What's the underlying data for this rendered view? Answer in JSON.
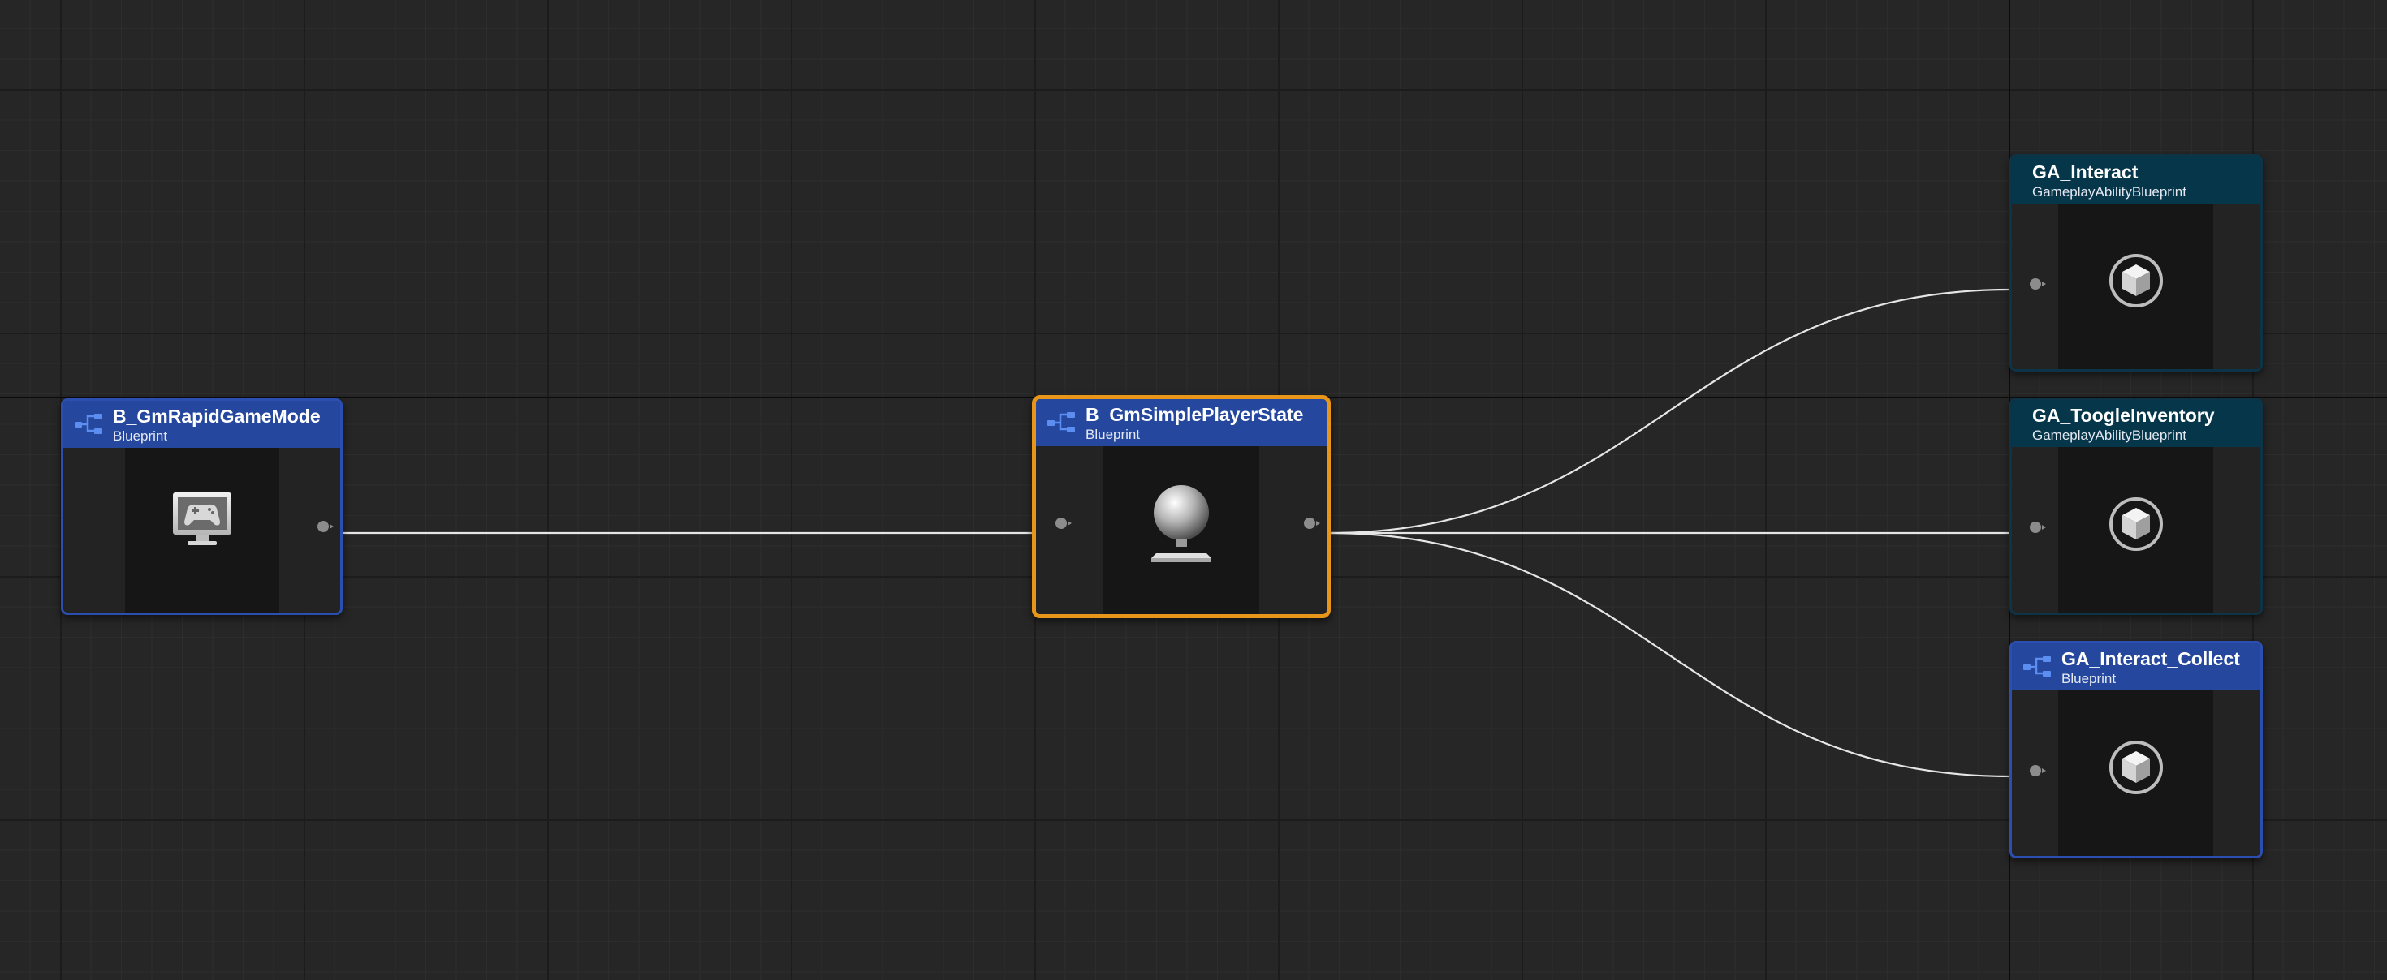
{
  "graph": {
    "nodes": [
      {
        "id": "game-mode",
        "title": "B_GmRapidGameMode",
        "subtitle": "Blueprint",
        "icon": "gamepad-monitor-icon",
        "header_icon": "blueprint-hierarchy-icon",
        "selected": false
      },
      {
        "id": "player-state",
        "title": "B_GmSimplePlayerState",
        "subtitle": "Blueprint",
        "icon": "sphere-pedestal-icon",
        "header_icon": "blueprint-hierarchy-icon",
        "selected": true
      },
      {
        "id": "ga-interact",
        "title": "GA_Interact",
        "subtitle": "GameplayAbilityBlueprint",
        "icon": "cube-circle-icon",
        "selected": false
      },
      {
        "id": "ga-toogle-inventory",
        "title": "GA_ToogleInventory",
        "subtitle": "GameplayAbilityBlueprint",
        "icon": "cube-circle-icon",
        "selected": false
      },
      {
        "id": "ga-interact-collect",
        "title": "GA_Interact_Collect",
        "subtitle": "Blueprint",
        "icon": "cube-circle-icon",
        "header_icon": "blueprint-hierarchy-icon",
        "selected": false
      }
    ],
    "connections": [
      {
        "from": "game-mode",
        "to": "player-state"
      },
      {
        "from": "player-state",
        "to": "ga-interact"
      },
      {
        "from": "player-state",
        "to": "ga-toogle-inventory"
      },
      {
        "from": "player-state",
        "to": "ga-interact-collect"
      }
    ]
  },
  "colors": {
    "blueprint_header": "#25489e",
    "blueprint_border": "#2a4fb0",
    "gameplay_ability_header": "#05364a",
    "selection_outline": "#e8961a",
    "wire": "#e6e6e6",
    "background": "#262626"
  }
}
